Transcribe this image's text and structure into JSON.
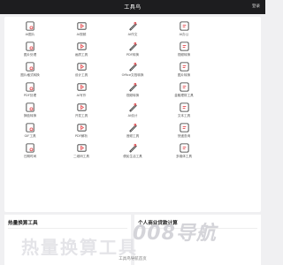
{
  "header": {
    "title": "工具鸟",
    "login": "登录"
  },
  "tools": [
    {
      "label": "AI图片",
      "icon": "ai-image-icon"
    },
    {
      "label": "AI视频",
      "icon": "ai-video-icon"
    },
    {
      "label": "AI作文",
      "icon": "ai-essay-icon"
    },
    {
      "label": "AI办公",
      "icon": "ai-office-icon"
    },
    {
      "label": "",
      "icon": "empty"
    },
    {
      "label": "图片处理",
      "icon": "image-process-icon"
    },
    {
      "label": "画质工具",
      "icon": "quality-tool-icon"
    },
    {
      "label": "PDF转换",
      "icon": "pdf-convert-icon"
    },
    {
      "label": "视频转换",
      "icon": "video-convert-icon"
    },
    {
      "label": "",
      "icon": "empty"
    },
    {
      "label": "图片格式转换",
      "icon": "image-format-icon"
    },
    {
      "label": "设计工具",
      "icon": "design-tool-icon"
    },
    {
      "label": "Office文档转换",
      "icon": "office-convert-icon"
    },
    {
      "label": "图片转换",
      "icon": "image-convert-icon"
    },
    {
      "label": "",
      "icon": "empty"
    },
    {
      "label": "PDF处理",
      "icon": "pdf-process-icon"
    },
    {
      "label": "AI写作",
      "icon": "ai-write-icon"
    },
    {
      "label": "视频转换",
      "icon": "video-switch-icon"
    },
    {
      "label": "金融理财工具",
      "icon": "finance-icon"
    },
    {
      "label": "",
      "icon": "empty"
    },
    {
      "label": "换脸转换",
      "icon": "face-swap-icon"
    },
    {
      "label": "开发工具",
      "icon": "dev-tool-icon"
    },
    {
      "label": "AI设计",
      "icon": "ai-design-icon"
    },
    {
      "label": "文本工具",
      "icon": "text-tool-icon"
    },
    {
      "label": "",
      "icon": "empty"
    },
    {
      "label": "GIF工具",
      "icon": "gif-tool-icon"
    },
    {
      "label": "PDF解析",
      "icon": "pdf-parse-icon"
    },
    {
      "label": "音频工具",
      "icon": "audio-tool-icon"
    },
    {
      "label": "快递查询",
      "icon": "express-icon"
    },
    {
      "label": "",
      "icon": "empty"
    },
    {
      "label": "日期时间",
      "icon": "datetime-icon"
    },
    {
      "label": "二维码工具",
      "icon": "qrcode-icon"
    },
    {
      "label": "便民生活工具",
      "icon": "life-tool-icon"
    },
    {
      "label": "多媒体工具",
      "icon": "media-tool-icon"
    },
    {
      "label": "",
      "icon": "empty"
    }
  ],
  "panels": {
    "left_title": "热量换算工具",
    "right_title": "个人商业贷款计算"
  },
  "watermark": {
    "left": "热量换算工具",
    "right": "008导航"
  },
  "footer": "工具鸟导航首页",
  "colors": {
    "accent": "#e5484d",
    "header_bg": "#1d1d1f",
    "icon_stroke": "#333333"
  }
}
